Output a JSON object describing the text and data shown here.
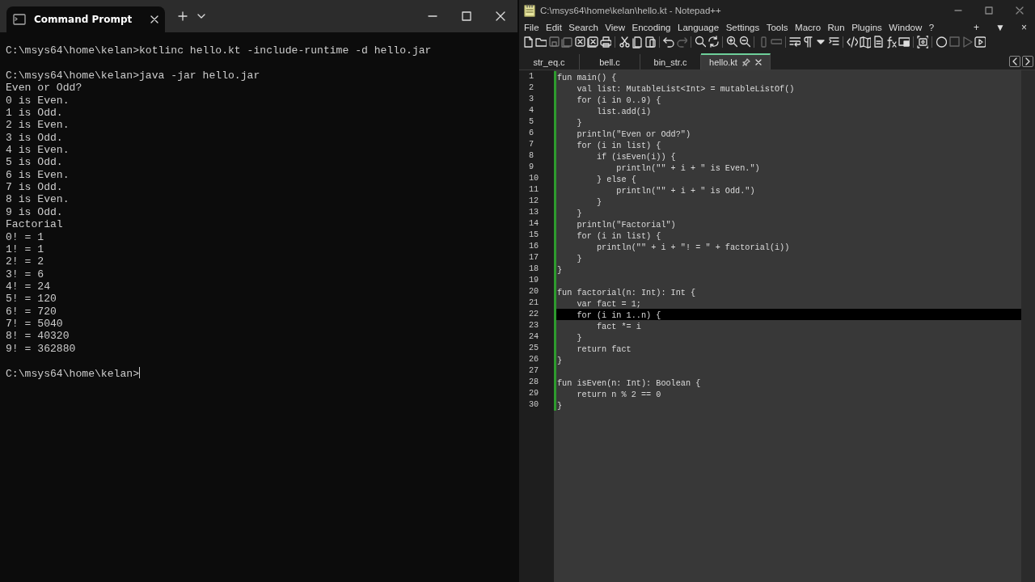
{
  "terminal": {
    "tab_title": "Command Prompt",
    "lines": [
      {
        "kind": "blank"
      },
      {
        "kind": "text",
        "text": "C:\\msys64\\home\\kelan>kotlinc hello.kt -include-runtime -d hello.jar"
      },
      {
        "kind": "blank"
      },
      {
        "kind": "text",
        "text": "C:\\msys64\\home\\kelan>java -jar hello.jar"
      },
      {
        "kind": "text",
        "text": "Even or Odd?"
      },
      {
        "kind": "text",
        "text": "0 is Even."
      },
      {
        "kind": "text",
        "text": "1 is Odd."
      },
      {
        "kind": "text",
        "text": "2 is Even."
      },
      {
        "kind": "text",
        "text": "3 is Odd."
      },
      {
        "kind": "text",
        "text": "4 is Even."
      },
      {
        "kind": "text",
        "text": "5 is Odd."
      },
      {
        "kind": "text",
        "text": "6 is Even."
      },
      {
        "kind": "text",
        "text": "7 is Odd."
      },
      {
        "kind": "text",
        "text": "8 is Even."
      },
      {
        "kind": "text",
        "text": "9 is Odd."
      },
      {
        "kind": "text",
        "text": "Factorial"
      },
      {
        "kind": "text",
        "text": "0! = 1"
      },
      {
        "kind": "text",
        "text": "1! = 1"
      },
      {
        "kind": "text",
        "text": "2! = 2"
      },
      {
        "kind": "text",
        "text": "3! = 6"
      },
      {
        "kind": "text",
        "text": "4! = 24"
      },
      {
        "kind": "text",
        "text": "5! = 120"
      },
      {
        "kind": "text",
        "text": "6! = 720"
      },
      {
        "kind": "text",
        "text": "7! = 5040"
      },
      {
        "kind": "text",
        "text": "8! = 40320"
      },
      {
        "kind": "text",
        "text": "9! = 362880"
      },
      {
        "kind": "blank"
      },
      {
        "kind": "prompt",
        "text": "C:\\msys64\\home\\kelan>"
      }
    ]
  },
  "editor": {
    "title": "C:\\msys64\\home\\kelan\\hello.kt - Notepad++",
    "menu": [
      "File",
      "Edit",
      "Search",
      "View",
      "Encoding",
      "Language",
      "Settings",
      "Tools",
      "Macro",
      "Run",
      "Plugins",
      "Window",
      "?"
    ],
    "menu_right": [
      "+",
      "▼",
      "×"
    ],
    "tabs": [
      {
        "label": "str_eq.c",
        "selected": false
      },
      {
        "label": "bell.c",
        "selected": false
      },
      {
        "label": "bin_str.c",
        "selected": false
      },
      {
        "label": "hello.kt",
        "selected": true
      }
    ],
    "code": [
      {
        "number": "1",
        "text": "fun main() {",
        "current": false
      },
      {
        "number": "2",
        "text": "    val list: MutableList<Int> = mutableListOf()",
        "current": false
      },
      {
        "number": "3",
        "text": "    for (i in 0..9) {",
        "current": false
      },
      {
        "number": "4",
        "text": "        list.add(i)",
        "current": false
      },
      {
        "number": "5",
        "text": "    }",
        "current": false
      },
      {
        "number": "6",
        "text": "    println(\"Even or Odd?\")",
        "current": false
      },
      {
        "number": "7",
        "text": "    for (i in list) {",
        "current": false
      },
      {
        "number": "8",
        "text": "        if (isEven(i)) {",
        "current": false
      },
      {
        "number": "9",
        "text": "            println(\"\" + i + \" is Even.\")",
        "current": false
      },
      {
        "number": "10",
        "text": "        } else {",
        "current": false
      },
      {
        "number": "11",
        "text": "            println(\"\" + i + \" is Odd.\")",
        "current": false
      },
      {
        "number": "12",
        "text": "        }",
        "current": false
      },
      {
        "number": "13",
        "text": "    }",
        "current": false
      },
      {
        "number": "14",
        "text": "    println(\"Factorial\")",
        "current": false
      },
      {
        "number": "15",
        "text": "    for (i in list) {",
        "current": false
      },
      {
        "number": "16",
        "text": "        println(\"\" + i + \"! = \" + factorial(i))",
        "current": false
      },
      {
        "number": "17",
        "text": "    }",
        "current": false
      },
      {
        "number": "18",
        "text": "}",
        "current": false
      },
      {
        "number": "19",
        "current": false
      },
      {
        "number": "20",
        "text": "fun factorial(n: Int): Int {",
        "current": false
      },
      {
        "number": "21",
        "text": "    var fact = 1;",
        "current": false
      },
      {
        "number": "22",
        "text": "    for (i in 1..n) {",
        "current": true
      },
      {
        "number": "23",
        "text": "        fact *= i",
        "current": false
      },
      {
        "number": "24",
        "text": "    }",
        "current": false
      },
      {
        "number": "25",
        "text": "    return fact",
        "current": false
      },
      {
        "number": "26",
        "text": "}",
        "current": false
      },
      {
        "number": "27",
        "current": false
      },
      {
        "number": "28",
        "text": "fun isEven(n: Int): Boolean {",
        "current": false
      },
      {
        "number": "29",
        "text": "    return n % 2 == 0",
        "current": false
      },
      {
        "number": "30",
        "text": "}",
        "current": false
      }
    ]
  }
}
